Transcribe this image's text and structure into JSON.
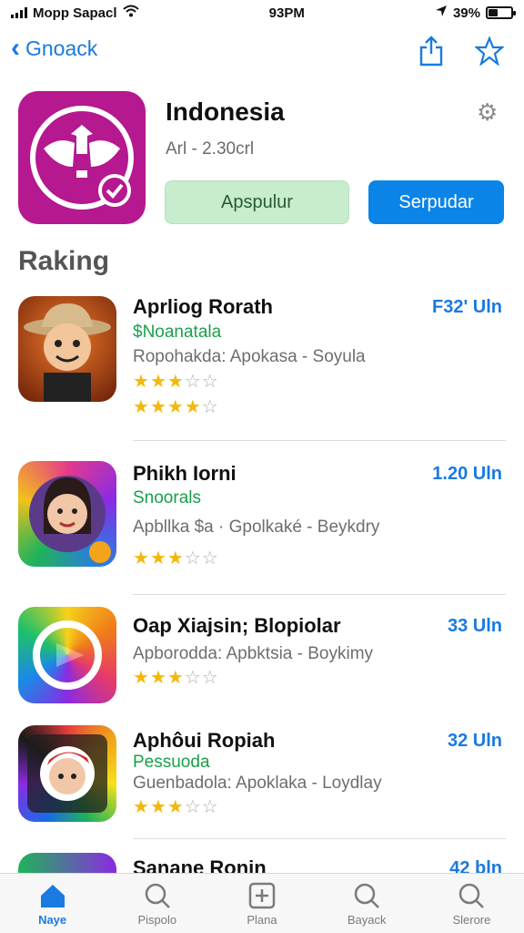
{
  "status": {
    "carrier": "Mopp Sapacl",
    "time": "93PM",
    "battery": "39%",
    "battery_level": 0.39
  },
  "nav": {
    "back_label": "Gnoack"
  },
  "app": {
    "title": "Indonesia",
    "subtitle": "Arl - 2.30crl",
    "primary_button": "Apspulur",
    "secondary_button": "Serpudar",
    "accent": "#1a7ae0",
    "icon_color": "#b5188f"
  },
  "section_title": "Raking",
  "rows": [
    {
      "title": "Aprliog Rorath",
      "price": "F32' Uln",
      "tag": "$Noanatala",
      "meta": "Ropohakda: Apokasa - Soyula",
      "ratings": [
        3,
        4
      ]
    },
    {
      "title": "Phikh Iorni",
      "price": "1.20 Uln",
      "tag": "Snoorals",
      "meta": "Apbllka $a · Gpolkaké - Beykdry",
      "ratings": [
        3
      ]
    },
    {
      "title": "Oap Xiajsin; Blopiolar",
      "price": "33 Uln",
      "tag": "",
      "meta": "Apborodda: Apbktsia - Boykimy",
      "ratings": [
        3
      ]
    },
    {
      "title": "Aphôui Ropiah",
      "price": "32 Uln",
      "tag": "Pessuoda",
      "meta": "Guenbadola: Apoklaka - Loydlay",
      "ratings": [
        3
      ]
    },
    {
      "title": "Sanane Ronin",
      "price": "42 bln",
      "tag": "",
      "meta": "",
      "ratings": []
    }
  ],
  "tabs": [
    {
      "label": "Naye",
      "icon": "home-icon",
      "active": true
    },
    {
      "label": "Pispolo",
      "icon": "search-icon",
      "active": false
    },
    {
      "label": "Plana",
      "icon": "plus-square-icon",
      "active": false
    },
    {
      "label": "Bayack",
      "icon": "search-icon",
      "active": false
    },
    {
      "label": "Slerore",
      "icon": "search-icon",
      "active": false
    }
  ]
}
